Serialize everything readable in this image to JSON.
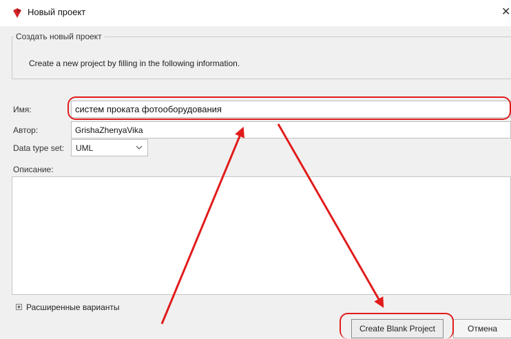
{
  "window": {
    "title": "Новый проект",
    "close_symbol": "✕",
    "icon": "visual-paradigm-logo-icon"
  },
  "section": {
    "legend": "Создать новый проект",
    "intro": "Create a new project by filling in the following information."
  },
  "form": {
    "name_label": "Имя:",
    "name_value": "систем проката фотооборудования",
    "author_label": "Автор:",
    "author_value": "GrishaZhenyaVika",
    "datatype_label": "Data type set:",
    "datatype_value": "UML",
    "description_label": "Описание:",
    "description_value": ""
  },
  "advanced": {
    "label": "Расширенные варианты"
  },
  "buttons": {
    "create": "Create Blank Project",
    "cancel": "Отмена"
  },
  "annotation": {
    "color": "#e11b1b"
  }
}
